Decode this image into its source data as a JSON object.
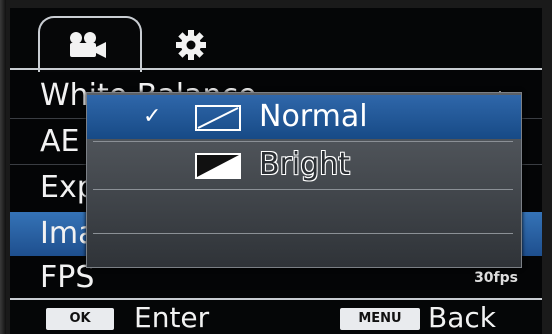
{
  "tabs": [
    {
      "icon": "video-camera-icon",
      "active": true
    },
    {
      "icon": "gear-icon",
      "active": false
    }
  ],
  "menu": {
    "items": [
      {
        "label": "White Balance",
        "value": "",
        "value_icon": "sun-icon"
      },
      {
        "label": "AE",
        "value": ""
      },
      {
        "label": "Exposure",
        "value": ""
      },
      {
        "label": "Image",
        "value": "",
        "selected": true
      },
      {
        "label": "FPS",
        "value": "30fps"
      }
    ]
  },
  "popup": {
    "options": [
      {
        "label": "Normal",
        "icon": "normal-contrast-icon",
        "checked": true,
        "selected": true
      },
      {
        "label": "Bright",
        "icon": "bright-contrast-icon",
        "checked": false,
        "selected": false
      }
    ],
    "check_glyph": "✓"
  },
  "bottom_bar": {
    "ok_key": "OK",
    "ok_label": "Enter",
    "menu_key": "MENU",
    "menu_label": "Back"
  },
  "colors": {
    "selection": "#2f67aa",
    "background": "#040506",
    "popup": "#4b5056"
  }
}
